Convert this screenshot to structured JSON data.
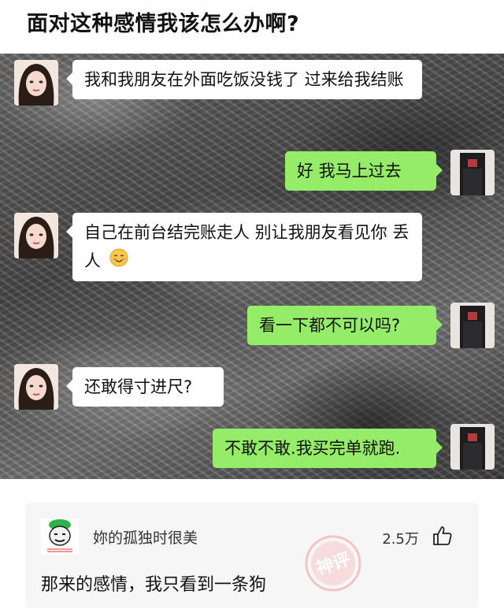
{
  "post": {
    "title": "面对这种感情我该怎么办啊?"
  },
  "chat": {
    "messages": [
      {
        "side": "left",
        "text": "我和我朋友在外面吃饭没钱了 过来给我结账"
      },
      {
        "side": "right",
        "text": "好  我马上过去"
      },
      {
        "side": "left",
        "text": "自己在前台结完账走人 别让我朋友看见你 丢人",
        "emoji": "blushing-smile-emoji"
      },
      {
        "side": "right",
        "text": "看一下都不可以吗?"
      },
      {
        "side": "left",
        "text": "还敢得寸进尺?"
      },
      {
        "side": "right",
        "text": "不敢不敢.我买完单就跑."
      }
    ],
    "colors": {
      "right_bubble": "#95ec69",
      "left_bubble": "#ffffff"
    }
  },
  "comment": {
    "username": "妳的孤独时很美",
    "likes": "2.5万",
    "like_icon": "thumbs-up-icon",
    "text": "那来的感情，我只看到一条狗",
    "stamp": "神评",
    "stamp_color": "#f08a8a"
  }
}
